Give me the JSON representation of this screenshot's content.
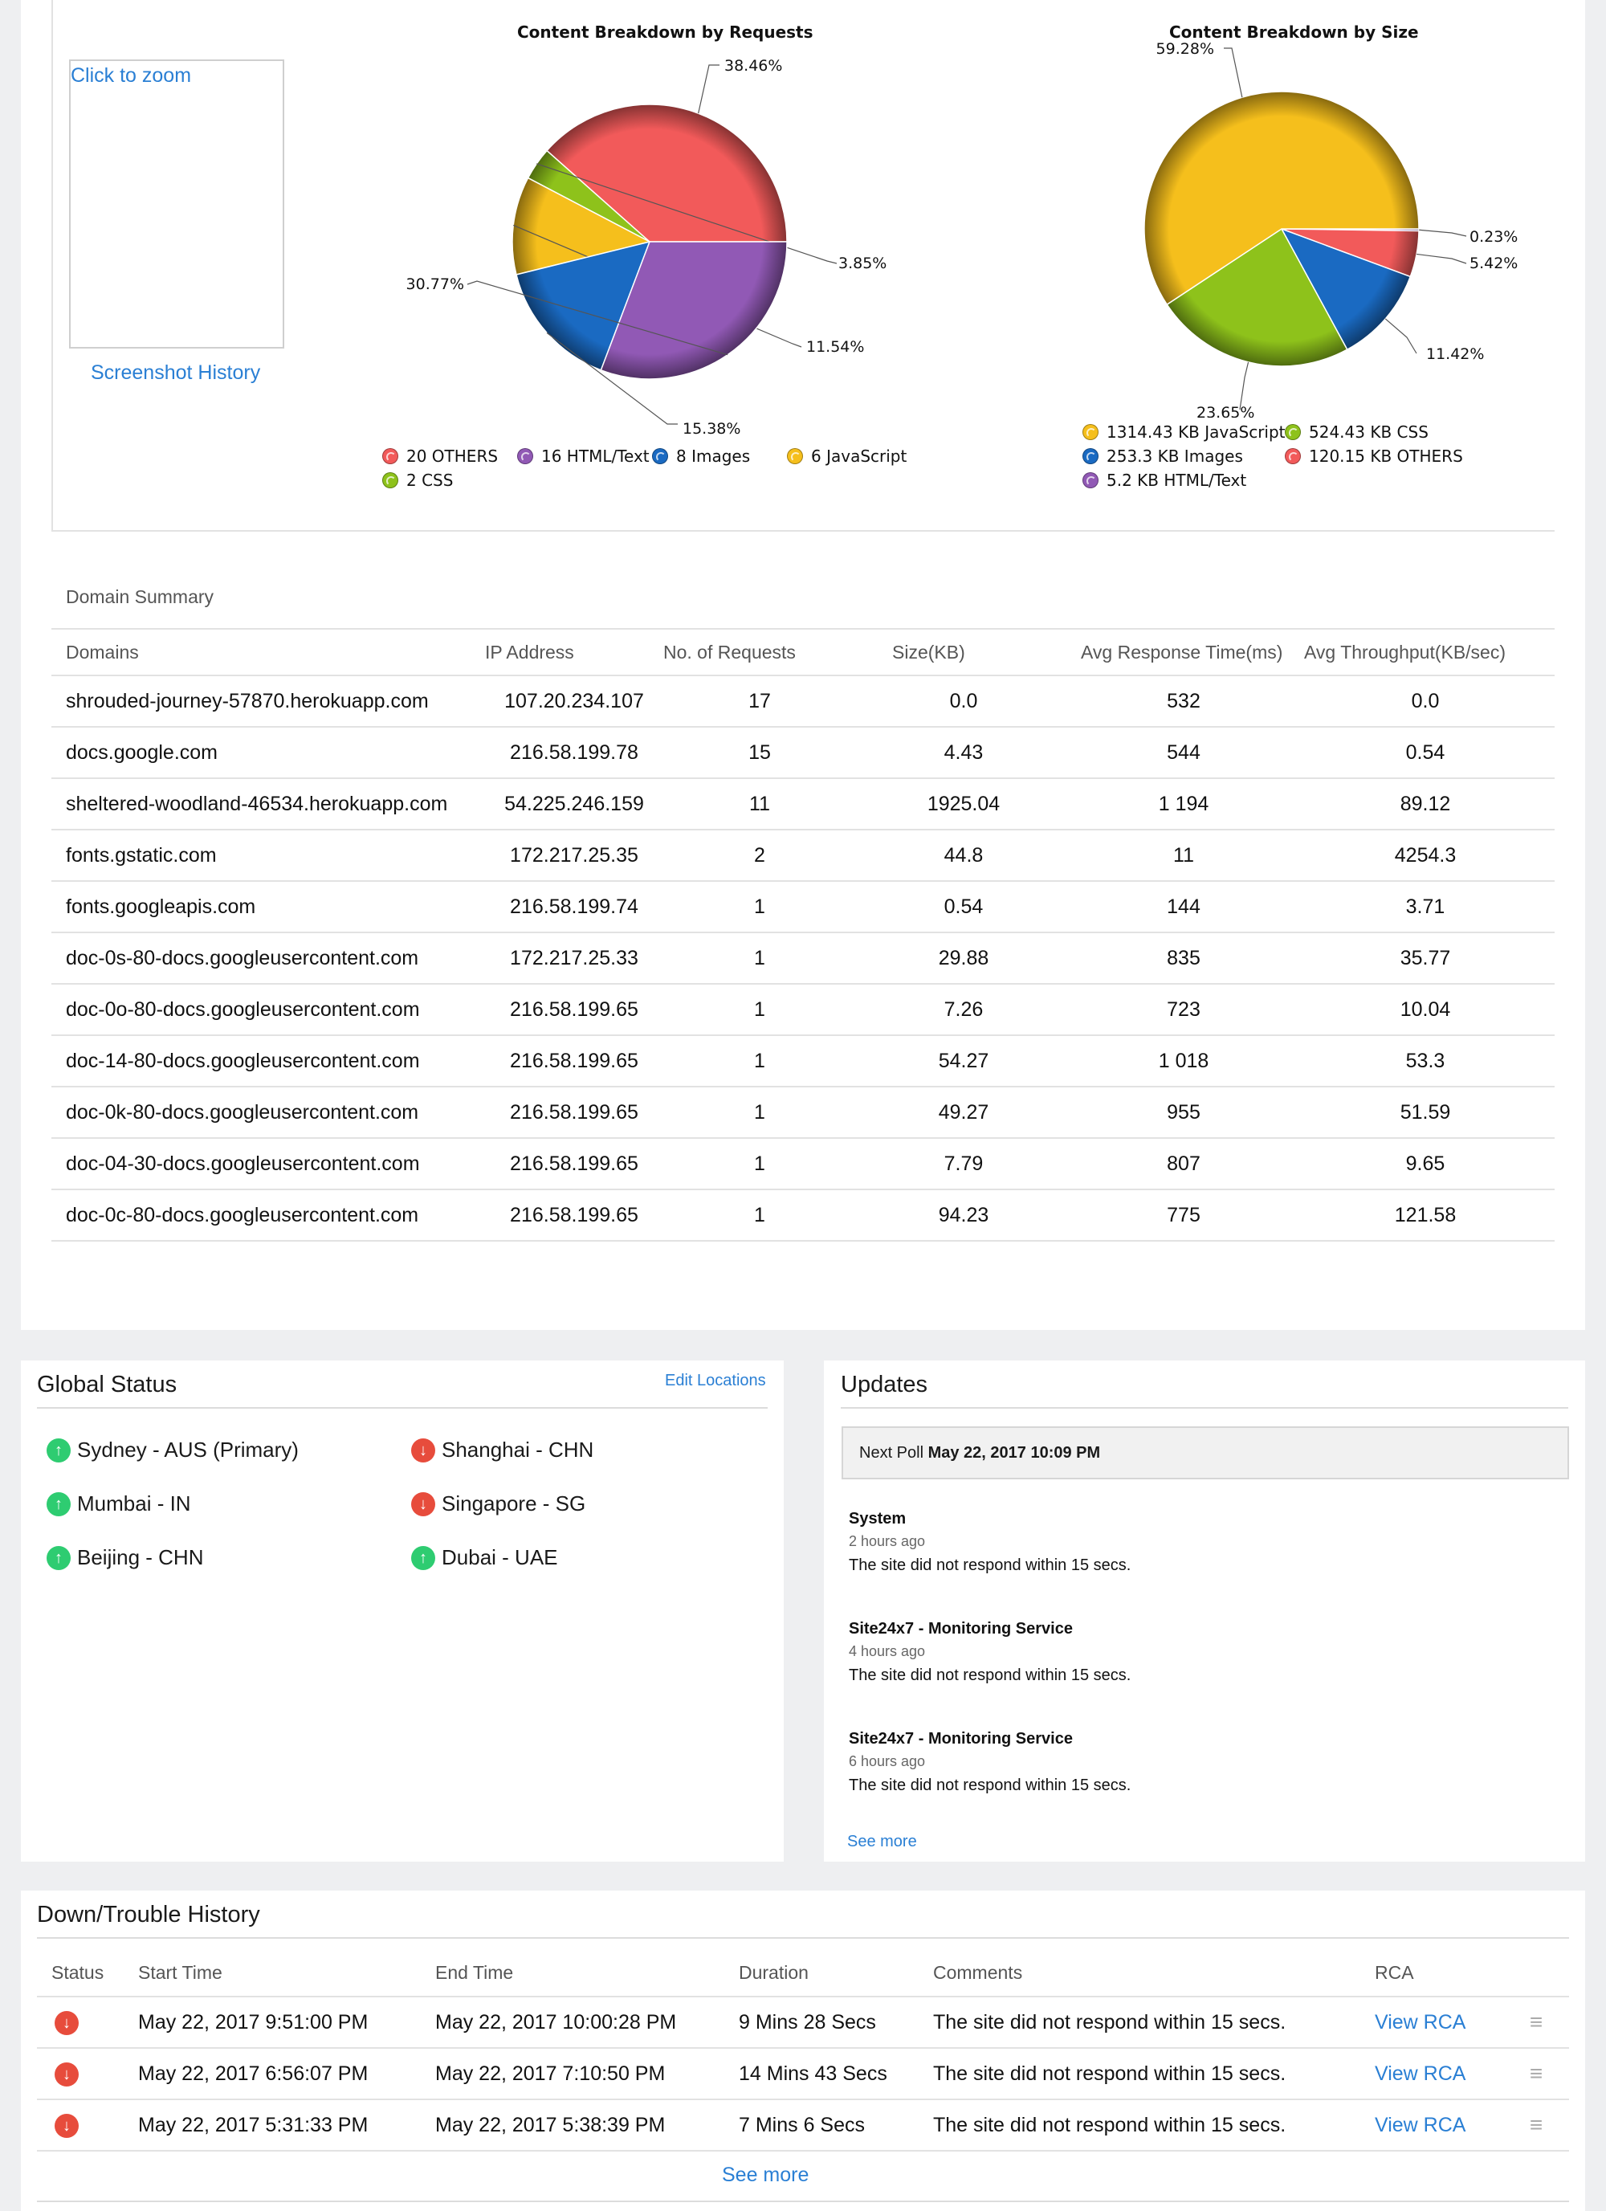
{
  "screenshot_panel": {
    "zoom_label": "Click to zoom",
    "history_link": "Screenshot History"
  },
  "chart_data": [
    {
      "type": "pie",
      "title": "Content Breakdown by Requests",
      "slices": [
        {
          "label": "20 OTHERS",
          "value": 38.46,
          "pct_label": "38.46%",
          "color": "#f25a5a"
        },
        {
          "label": "2 CSS",
          "value": 3.85,
          "pct_label": "3.85%",
          "color": "#8ec21b"
        },
        {
          "label": "6 JavaScript",
          "value": 11.54,
          "pct_label": "11.54%",
          "color": "#f5bf1c"
        },
        {
          "label": "8 Images",
          "value": 15.38,
          "pct_label": "15.38%",
          "color": "#1a6ac2"
        },
        {
          "label": "16 HTML/Text",
          "value": 30.77,
          "pct_label": "30.77%",
          "color": "#9159b5"
        }
      ]
    },
    {
      "type": "pie",
      "title": "Content Breakdown by Size",
      "slices": [
        {
          "label": "5.2 KB HTML/Text",
          "value": 0.23,
          "pct_label": "0.23%",
          "color": "#9159b5"
        },
        {
          "label": "120.15 KB OTHERS",
          "value": 5.42,
          "pct_label": "5.42%",
          "color": "#f25a5a"
        },
        {
          "label": "253.3 KB Images",
          "value": 11.42,
          "pct_label": "11.42%",
          "color": "#1a6ac2"
        },
        {
          "label": "524.43 KB CSS",
          "value": 23.65,
          "pct_label": "23.65%",
          "color": "#8ec21b"
        },
        {
          "label": "1314.43 KB JavaScript",
          "value": 59.28,
          "pct_label": "59.28%",
          "color": "#f5bf1c"
        }
      ]
    }
  ],
  "domain_summary": {
    "title": "Domain Summary",
    "columns": [
      "Domains",
      "IP Address",
      "No. of Requests",
      "Size(KB)",
      "Avg Response Time(ms)",
      "Avg Throughput(KB/sec)"
    ],
    "rows": [
      [
        "shrouded-journey-57870.herokuapp.com",
        "107.20.234.107",
        "17",
        "0.0",
        "532",
        "0.0"
      ],
      [
        "docs.google.com",
        "216.58.199.78",
        "15",
        "4.43",
        "544",
        "0.54"
      ],
      [
        "sheltered-woodland-46534.herokuapp.com",
        "54.225.246.159",
        "11",
        "1925.04",
        "1 194",
        "89.12"
      ],
      [
        "fonts.gstatic.com",
        "172.217.25.35",
        "2",
        "44.8",
        "11",
        "4254.3"
      ],
      [
        "fonts.googleapis.com",
        "216.58.199.74",
        "1",
        "0.54",
        "144",
        "3.71"
      ],
      [
        "doc-0s-80-docs.googleusercontent.com",
        "172.217.25.33",
        "1",
        "29.88",
        "835",
        "35.77"
      ],
      [
        "doc-0o-80-docs.googleusercontent.com",
        "216.58.199.65",
        "1",
        "7.26",
        "723",
        "10.04"
      ],
      [
        "doc-14-80-docs.googleusercontent.com",
        "216.58.199.65",
        "1",
        "54.27",
        "1 018",
        "53.3"
      ],
      [
        "doc-0k-80-docs.googleusercontent.com",
        "216.58.199.65",
        "1",
        "49.27",
        "955",
        "51.59"
      ],
      [
        "doc-04-30-docs.googleusercontent.com",
        "216.58.199.65",
        "1",
        "7.79",
        "807",
        "9.65"
      ],
      [
        "doc-0c-80-docs.googleusercontent.com",
        "216.58.199.65",
        "1",
        "94.23",
        "775",
        "121.58"
      ]
    ]
  },
  "global_status": {
    "title": "Global Status",
    "edit_link": "Edit Locations",
    "locations": [
      {
        "name": "Sydney - AUS (Primary)",
        "status": "up"
      },
      {
        "name": "Shanghai - CHN",
        "status": "down"
      },
      {
        "name": "Mumbai - IN",
        "status": "up"
      },
      {
        "name": "Singapore - SG",
        "status": "down"
      },
      {
        "name": "Beijing - CHN",
        "status": "up"
      },
      {
        "name": "Dubai - UAE",
        "status": "up"
      }
    ]
  },
  "updates": {
    "title": "Updates",
    "next_poll_label": "Next Poll",
    "next_poll_value": "May 22, 2017 10:09 PM",
    "items": [
      {
        "source": "System",
        "time": "2 hours ago",
        "message": "The site did not respond within 15 secs."
      },
      {
        "source": "Site24x7 - Monitoring Service",
        "time": "4 hours ago",
        "message": "The site did not respond within 15 secs."
      },
      {
        "source": "Site24x7 - Monitoring Service",
        "time": "6 hours ago",
        "message": "The site did not respond within 15 secs."
      }
    ],
    "see_more": "See more"
  },
  "down_history": {
    "title": "Down/Trouble History",
    "columns": [
      "Status",
      "Start Time",
      "End Time",
      "Duration",
      "Comments",
      "RCA"
    ],
    "rows": [
      {
        "start": "May 22, 2017 9:51:00 PM",
        "end": "May 22, 2017 10:00:28 PM",
        "duration": "9 Mins 28 Secs",
        "comment": "The site did not respond within 15 secs.",
        "rca": "View RCA"
      },
      {
        "start": "May 22, 2017 6:56:07 PM",
        "end": "May 22, 2017 7:10:50 PM",
        "duration": "14 Mins 43 Secs",
        "comment": "The site did not respond within 15 secs.",
        "rca": "View RCA"
      },
      {
        "start": "May 22, 2017 5:31:33 PM",
        "end": "May 22, 2017 5:38:39 PM",
        "duration": "7 Mins 6 Secs",
        "comment": "The site did not respond within 15 secs.",
        "rca": "View RCA"
      }
    ],
    "see_more": "See more"
  }
}
